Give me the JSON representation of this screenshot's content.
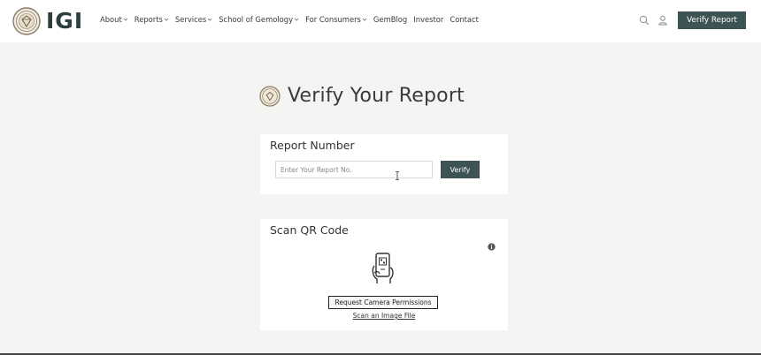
{
  "header": {
    "logo_text": "IGI",
    "nav": [
      {
        "label": "About",
        "has_dropdown": true
      },
      {
        "label": "Reports",
        "has_dropdown": true
      },
      {
        "label": "Services",
        "has_dropdown": true
      },
      {
        "label": "School of Gemology",
        "has_dropdown": true
      },
      {
        "label": "For Consumers",
        "has_dropdown": true
      },
      {
        "label": "GemBlog",
        "has_dropdown": false
      },
      {
        "label": "Investor",
        "has_dropdown": false
      },
      {
        "label": "Contact",
        "has_dropdown": false
      }
    ],
    "tools": [
      "search-icon",
      "user-icon"
    ],
    "verify_button_label": "Verify Report"
  },
  "main": {
    "title": "Verify Your Report",
    "report_card": {
      "heading": "Report Number",
      "input_placeholder": "Enter Your Report No.",
      "input_value": "",
      "verify_label": "Verify"
    },
    "qr_card": {
      "heading": "Scan QR Code",
      "camera_button_label": "Request Camera Permissions",
      "scan_file_link": "Scan an Image File"
    }
  },
  "colors": {
    "accent": "#3e5353",
    "page_background": "#f4f4f3",
    "card_background": "#ffffff"
  }
}
